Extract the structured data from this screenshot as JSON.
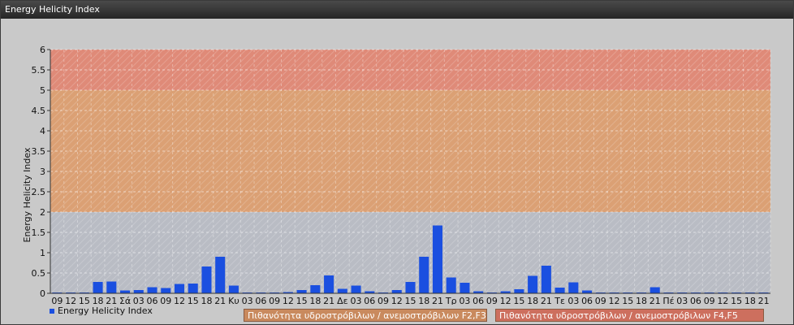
{
  "window": {
    "title": "Energy Helicity Index"
  },
  "chart_data": {
    "type": "bar",
    "ylabel": "Energy Helicity Index",
    "ylim": [
      0,
      6
    ],
    "yticks": [
      "0",
      "0.5",
      "1",
      "1.5",
      "2",
      "2.5",
      "3",
      "3.5",
      "4",
      "4.5",
      "5",
      "5.5",
      "6"
    ],
    "grid": true,
    "legend_position": "bottom-left",
    "bands": [
      {
        "from": 0,
        "to": 2,
        "color": "#b9bcc4"
      },
      {
        "from": 2,
        "to": 5,
        "color": "#dba074"
      },
      {
        "from": 5,
        "to": 6,
        "color": "#df8a78"
      }
    ],
    "categories": [
      "09",
      "12",
      "15",
      "18",
      "21",
      "Σά",
      "03",
      "06",
      "09",
      "12",
      "15",
      "18",
      "21",
      "Κυ",
      "03",
      "06",
      "09",
      "12",
      "15",
      "18",
      "21",
      "Δε",
      "03",
      "06",
      "09",
      "12",
      "15",
      "18",
      "21",
      "Τρ",
      "03",
      "06",
      "09",
      "12",
      "15",
      "18",
      "21",
      "Τε",
      "03",
      "06",
      "09",
      "12",
      "15",
      "18",
      "21",
      "Πέ",
      "03",
      "06",
      "09",
      "12",
      "15",
      "18",
      "21"
    ],
    "series": [
      {
        "name": "Energy Helicity Index",
        "color": "#1a4fe0",
        "values": [
          0.01,
          0.01,
          0.02,
          0.28,
          0.29,
          0.07,
          0.08,
          0.15,
          0.13,
          0.23,
          0.24,
          0.66,
          0.9,
          0.19,
          0.01,
          0.01,
          0.01,
          0.03,
          0.08,
          0.2,
          0.44,
          0.11,
          0.19,
          0.05,
          0.02,
          0.08,
          0.28,
          0.9,
          1.67,
          0.39,
          0.26,
          0.05,
          0.02,
          0.05,
          0.1,
          0.43,
          0.68,
          0.14,
          0.27,
          0.07,
          0.01,
          0.02,
          0.02,
          0.01,
          0.15,
          0.01,
          0.01,
          0.01,
          0.01,
          0.01,
          0.01,
          0.01,
          0.01
        ]
      }
    ]
  },
  "legend": {
    "series_label": "Energy Helicity Index",
    "band_labels": [
      {
        "text": "Πιθανότητα υδροστρόβιλων / ανεμοστρόβιλων F2,F3",
        "color": "#c98a5e"
      },
      {
        "text": "Πιθανότητα υδροστρόβιλων / ανεμοστρόβιλων F4,F5",
        "color": "#cd6f5e"
      }
    ]
  }
}
